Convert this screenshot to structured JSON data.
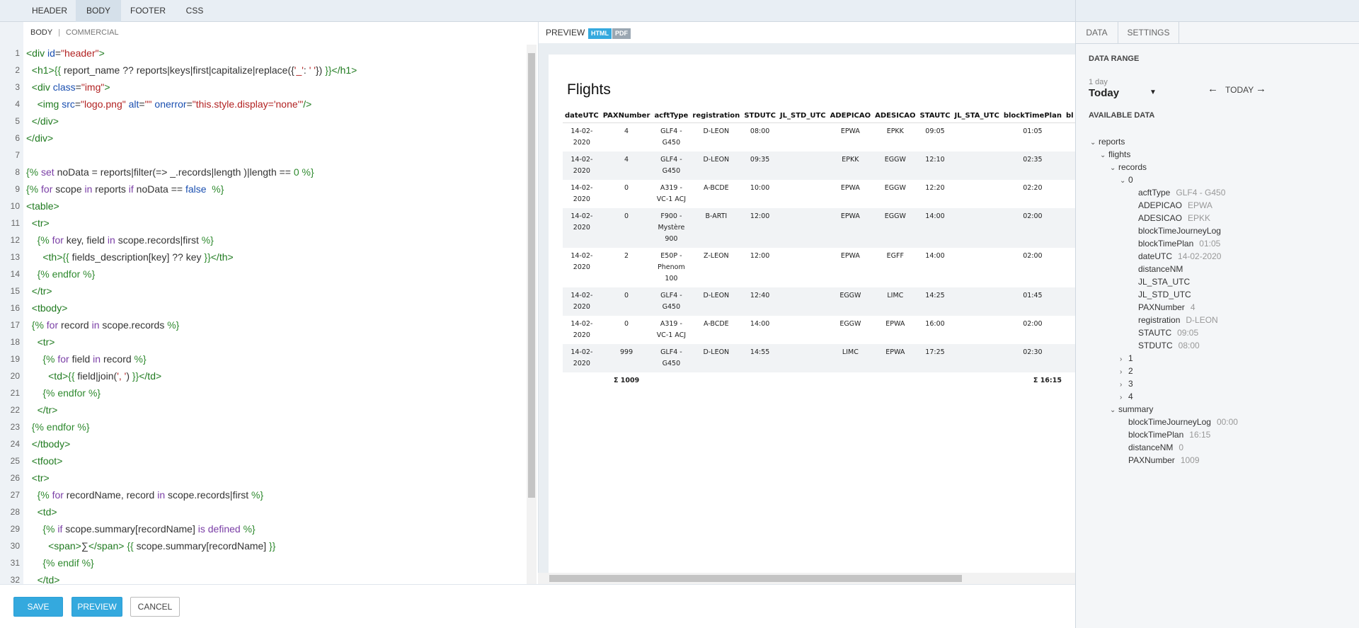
{
  "tabs": [
    "HEADER",
    "BODY",
    "FOOTER",
    "CSS"
  ],
  "editor": {
    "tab": "BODY",
    "subtab": "COMMERCIAL",
    "lines": [
      {
        "n": "1",
        "html": "<span class=\"tag\">&lt;div </span><span class=\"attr\">id</span>=<span class=\"str\">\"header\"</span><span class=\"tag\">&gt;</span>"
      },
      {
        "n": "2",
        "html": "  <span class=\"tag\">&lt;h1&gt;</span><span class=\"g\">{{</span> report_name ?? reports|keys|first|capitalize|replace({<span class=\"str\">'_'</span>: <span class=\"str\">' '</span>}) <span class=\"g\">}}</span><span class=\"tag\">&lt;/h1&gt;</span>"
      },
      {
        "n": "3",
        "html": "  <span class=\"tag\">&lt;div </span><span class=\"attr\">class</span>=<span class=\"str\">\"img\"</span><span class=\"tag\">&gt;</span>"
      },
      {
        "n": "4",
        "html": "    <span class=\"tag\">&lt;img </span><span class=\"attr\">src</span>=<span class=\"str\">\"logo.png\"</span> <span class=\"attr\">alt</span>=<span class=\"str\">\"\"</span> <span class=\"attr\">onerror</span>=<span class=\"str\">\"this.style.display='none'\"</span><span class=\"tag\">/&gt;</span>"
      },
      {
        "n": "5",
        "html": "  <span class=\"tag\">&lt;/div&gt;</span>"
      },
      {
        "n": "6",
        "html": "<span class=\"tag\">&lt;/div&gt;</span>"
      },
      {
        "n": "7",
        "html": ""
      },
      {
        "n": "8",
        "html": "<span class=\"g\">{%</span> <span class=\"kw\">set</span> noData = reports|filter(=&gt; _.records|length )|length == <span class=\"g\">0</span> <span class=\"g\">%}</span>"
      },
      {
        "n": "9",
        "html": "<span class=\"g\">{%</span> <span class=\"kw\">for</span> scope <span class=\"kw\">in</span> reports <span class=\"kw\">if</span> noData == <span class=\"attr\">false</span>  <span class=\"g\">%}</span>"
      },
      {
        "n": "10",
        "html": "<span class=\"tag\">&lt;table&gt;</span>"
      },
      {
        "n": "11",
        "html": "  <span class=\"tag\">&lt;tr&gt;</span>"
      },
      {
        "n": "12",
        "html": "    <span class=\"g\">{%</span> <span class=\"kw\">for</span> key, field <span class=\"kw\">in</span> scope.records|first <span class=\"g\">%}</span>"
      },
      {
        "n": "13",
        "html": "      <span class=\"tag\">&lt;th&gt;</span><span class=\"g\">{{</span> fields_description[key] ?? key <span class=\"g\">}}</span><span class=\"tag\">&lt;/th&gt;</span>"
      },
      {
        "n": "14",
        "html": "    <span class=\"g\">{% endfor %}</span>"
      },
      {
        "n": "15",
        "html": "  <span class=\"tag\">&lt;/tr&gt;</span>"
      },
      {
        "n": "16",
        "html": "  <span class=\"tag\">&lt;tbody&gt;</span>"
      },
      {
        "n": "17",
        "html": "  <span class=\"g\">{%</span> <span class=\"kw\">for</span> record <span class=\"kw\">in</span> scope.records <span class=\"g\">%}</span>"
      },
      {
        "n": "18",
        "html": "    <span class=\"tag\">&lt;tr&gt;</span>"
      },
      {
        "n": "19",
        "html": "      <span class=\"g\">{%</span> <span class=\"kw\">for</span> field <span class=\"kw\">in</span> record <span class=\"g\">%}</span>"
      },
      {
        "n": "20",
        "html": "        <span class=\"tag\">&lt;td&gt;</span><span class=\"g\">{{</span> field|join(<span class=\"str\">', '</span>) <span class=\"g\">}}</span><span class=\"tag\">&lt;/td&gt;</span>"
      },
      {
        "n": "21",
        "html": "      <span class=\"g\">{% endfor %}</span>"
      },
      {
        "n": "22",
        "html": "    <span class=\"tag\">&lt;/tr&gt;</span>"
      },
      {
        "n": "23",
        "html": "  <span class=\"g\">{% endfor %}</span>"
      },
      {
        "n": "24",
        "html": "  <span class=\"tag\">&lt;/tbody&gt;</span>"
      },
      {
        "n": "25",
        "html": "  <span class=\"tag\">&lt;tfoot&gt;</span>"
      },
      {
        "n": "26",
        "html": "  <span class=\"tag\">&lt;tr&gt;</span>"
      },
      {
        "n": "27",
        "html": "    <span class=\"g\">{%</span> <span class=\"kw\">for</span> recordName, record <span class=\"kw\">in</span> scope.records|first <span class=\"g\">%}</span>"
      },
      {
        "n": "28",
        "html": "    <span class=\"tag\">&lt;td&gt;</span>"
      },
      {
        "n": "29",
        "html": "      <span class=\"g\">{%</span> <span class=\"kw\">if</span> scope.summary[recordName] <span class=\"kw\">is defined</span> <span class=\"g\">%}</span>"
      },
      {
        "n": "30",
        "html": "        <span class=\"tag\">&lt;span&gt;</span>∑<span class=\"tag\">&lt;/span&gt;</span> <span class=\"g\">{{</span> scope.summary[recordName] <span class=\"g\">}}</span>"
      },
      {
        "n": "31",
        "html": "      <span class=\"g\">{% endif %}</span>"
      },
      {
        "n": "32",
        "html": "    <span class=\"tag\">&lt;/td&gt;</span>"
      }
    ]
  },
  "buttons": {
    "save": "SAVE",
    "preview": "PREVIEW",
    "cancel": "CANCEL"
  },
  "preview": {
    "label": "PREVIEW",
    "pill_html": "HTML",
    "pill_pdf": "PDF",
    "title": "Flights",
    "columns": [
      "dateUTC",
      "PAXNumber",
      "acftType",
      "registration",
      "STDUTC",
      "JL_STD_UTC",
      "ADEPICAO",
      "ADESICAO",
      "STAUTC",
      "JL_STA_UTC",
      "blockTimePlan",
      "bl"
    ],
    "rows": [
      [
        "14-02-2020",
        "4",
        "GLF4 - G450",
        "D-LEON",
        "08:00",
        "",
        "EPWA",
        "EPKK",
        "09:05",
        "",
        "01:05",
        ""
      ],
      [
        "14-02-2020",
        "4",
        "GLF4 - G450",
        "D-LEON",
        "09:35",
        "",
        "EPKK",
        "EGGW",
        "12:10",
        "",
        "02:35",
        ""
      ],
      [
        "14-02-2020",
        "0",
        "A319 - VC-1 ACJ",
        "A-BCDE",
        "10:00",
        "",
        "EPWA",
        "EGGW",
        "12:20",
        "",
        "02:20",
        ""
      ],
      [
        "14-02-2020",
        "0",
        "F900 - Mystère 900",
        "B-ARTI",
        "12:00",
        "",
        "EPWA",
        "EGGW",
        "14:00",
        "",
        "02:00",
        ""
      ],
      [
        "14-02-2020",
        "2",
        "E50P - Phenom 100",
        "Z-LEON",
        "12:00",
        "",
        "EPWA",
        "EGFF",
        "14:00",
        "",
        "02:00",
        ""
      ],
      [
        "14-02-2020",
        "0",
        "GLF4 - G450",
        "D-LEON",
        "12:40",
        "",
        "EGGW",
        "LIMC",
        "14:25",
        "",
        "01:45",
        ""
      ],
      [
        "14-02-2020",
        "0",
        "A319 - VC-1 ACJ",
        "A-BCDE",
        "14:00",
        "",
        "EGGW",
        "EPWA",
        "16:00",
        "",
        "02:00",
        ""
      ],
      [
        "14-02-2020",
        "999",
        "GLF4 - G450",
        "D-LEON",
        "14:55",
        "",
        "LIMC",
        "EPWA",
        "17:25",
        "",
        "02:30",
        ""
      ]
    ],
    "footer_row": [
      "",
      "Σ 1009",
      "",
      "",
      "",
      "",
      "",
      "",
      "",
      "",
      "Σ 16:15",
      ""
    ]
  },
  "right": {
    "tabs": [
      "DATA",
      "SETTINGS"
    ],
    "data_range_title": "DATA RANGE",
    "range_sub": "1 day",
    "range_main": "Today",
    "today_label": "TODAY",
    "available_title": "AVAILABLE DATA",
    "tree": [
      {
        "lvl": 0,
        "chev": "⌄",
        "label": "reports",
        "val": ""
      },
      {
        "lvl": 1,
        "chev": "⌄",
        "label": "flights",
        "val": ""
      },
      {
        "lvl": 2,
        "chev": "⌄",
        "label": "records",
        "val": ""
      },
      {
        "lvl": 3,
        "chev": "⌄",
        "label": "0",
        "val": ""
      },
      {
        "lvl": 4,
        "chev": "",
        "label": "acftType",
        "val": "GLF4 - G450"
      },
      {
        "lvl": 4,
        "chev": "",
        "label": "ADEPICAO",
        "val": "EPWA"
      },
      {
        "lvl": 4,
        "chev": "",
        "label": "ADESICAO",
        "val": "EPKK"
      },
      {
        "lvl": 4,
        "chev": "",
        "label": "blockTimeJourneyLog",
        "val": ""
      },
      {
        "lvl": 4,
        "chev": "",
        "label": "blockTimePlan",
        "val": "01:05"
      },
      {
        "lvl": 4,
        "chev": "",
        "label": "dateUTC",
        "val": "14-02-2020"
      },
      {
        "lvl": 4,
        "chev": "",
        "label": "distanceNM",
        "val": ""
      },
      {
        "lvl": 4,
        "chev": "",
        "label": "JL_STA_UTC",
        "val": ""
      },
      {
        "lvl": 4,
        "chev": "",
        "label": "JL_STD_UTC",
        "val": ""
      },
      {
        "lvl": 4,
        "chev": "",
        "label": "PAXNumber",
        "val": "4"
      },
      {
        "lvl": 4,
        "chev": "",
        "label": "registration",
        "val": "D-LEON"
      },
      {
        "lvl": 4,
        "chev": "",
        "label": "STAUTC",
        "val": "09:05"
      },
      {
        "lvl": 4,
        "chev": "",
        "label": "STDUTC",
        "val": "08:00"
      },
      {
        "lvl": 3,
        "chev": "›",
        "label": "1",
        "val": ""
      },
      {
        "lvl": 3,
        "chev": "›",
        "label": "2",
        "val": ""
      },
      {
        "lvl": 3,
        "chev": "›",
        "label": "3",
        "val": ""
      },
      {
        "lvl": 3,
        "chev": "›",
        "label": "4",
        "val": ""
      },
      {
        "lvl": 2,
        "chev": "⌄",
        "label": "summary",
        "val": ""
      },
      {
        "lvl": 3,
        "chev": "",
        "label": "blockTimeJourneyLog",
        "val": "00:00"
      },
      {
        "lvl": 3,
        "chev": "",
        "label": "blockTimePlan",
        "val": "16:15"
      },
      {
        "lvl": 3,
        "chev": "",
        "label": "distanceNM",
        "val": "0"
      },
      {
        "lvl": 3,
        "chev": "",
        "label": "PAXNumber",
        "val": "1009"
      }
    ]
  }
}
